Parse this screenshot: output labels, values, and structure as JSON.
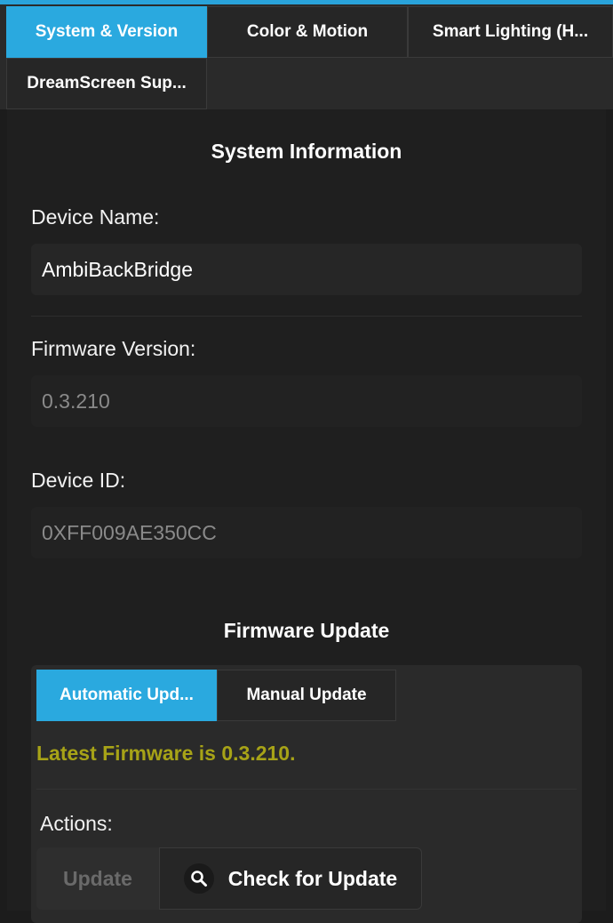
{
  "tabs": [
    {
      "label": "System & Version",
      "active": true
    },
    {
      "label": "Color & Motion",
      "active": false
    },
    {
      "label": "Smart Lighting (H...",
      "active": false
    },
    {
      "label": "DreamScreen Sup...",
      "active": false
    }
  ],
  "system_info": {
    "heading": "System Information",
    "device_name_label": "Device Name:",
    "device_name_value": "AmbiBackBridge",
    "firmware_version_label": "Firmware Version:",
    "firmware_version_value": "0.3.210",
    "device_id_label": "Device ID:",
    "device_id_value": "0XFF009AE350CC"
  },
  "firmware_update": {
    "heading": "Firmware Update",
    "tabs": [
      {
        "label": "Automatic Upd...",
        "active": true
      },
      {
        "label": "Manual Update",
        "active": false
      }
    ],
    "status": "Latest Firmware is 0.3.210.",
    "actions_label": "Actions:",
    "update_button": "Update",
    "check_button": "Check for Update"
  },
  "colors": {
    "accent": "#2aa9df",
    "status_text": "#a7a317"
  },
  "icons": {
    "check_button_icon": "search-icon"
  }
}
